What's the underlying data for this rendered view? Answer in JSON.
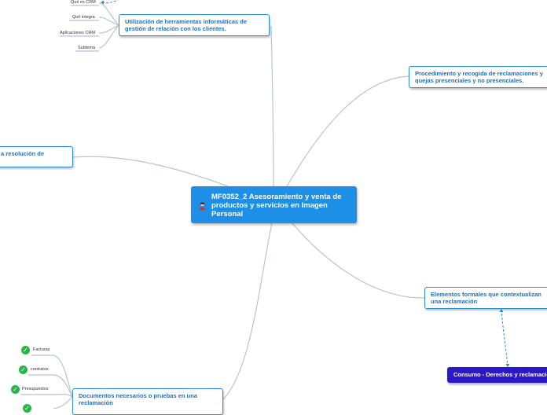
{
  "center": {
    "title": "MF0352_2 Asesoramiento y venta de productos y servicios en Imagen Personal",
    "icon": "person-avatar-icon"
  },
  "topics": {
    "crm": "Utilización de herramientas informáticas de gestión de relación con los clientes.",
    "complaints": "Procedimiento y recogida de reclamaciones y quejas presenciales y no presenciales.",
    "resolution": "a resolución de",
    "formal": "Elementos formales que contextualizan una reclamación",
    "consumer": "Consumo - Derechos y reclamaciones",
    "documents": "Documentos necesarios o pruebas en una reclamación"
  },
  "crm_leaves": [
    "Qué es CRM",
    "Qué integra",
    "Aplicaciones CRM",
    "Subtema"
  ],
  "doc_leaves": [
    "Facturas",
    "contratos",
    "Presupuestos"
  ],
  "colors": {
    "center": "#1e8fe6",
    "topic_border": "#2b8fd6",
    "topic_text": "#1f6fbf",
    "consumer_node": "#2a18c9",
    "check": "#2bb34a",
    "links": "#b9c3cc"
  }
}
